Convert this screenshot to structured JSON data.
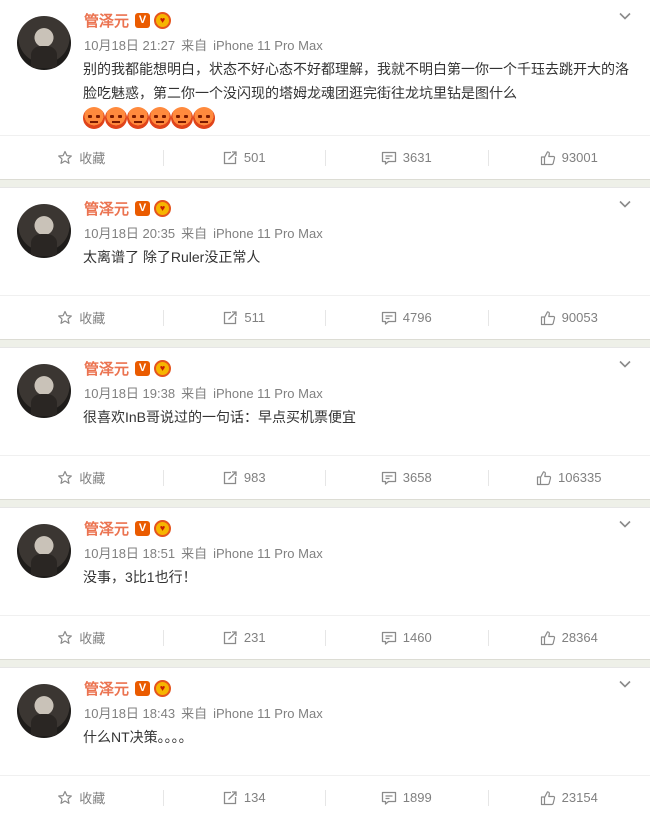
{
  "posts": [
    {
      "author": "管泽元",
      "date": "10月18日 21:27",
      "source_prefix": "来自",
      "device": "iPhone 11 Pro Max",
      "text": "别的我都能想明白，状态不好心态不好都理解，我就不明白第一你一个千珏去跳开大的洛脸吃魅惑，第二你一个没闪现的塔姆龙魂团逛完街往龙坑里钻是图什么",
      "emoji_count": 6,
      "favorite_label": "收藏",
      "reposts": "501",
      "comments": "3631",
      "likes": "93001"
    },
    {
      "author": "管泽元",
      "date": "10月18日 20:35",
      "source_prefix": "来自",
      "device": "iPhone 11 Pro Max",
      "text": "太离谱了 除了Ruler没正常人",
      "emoji_count": 0,
      "favorite_label": "收藏",
      "reposts": "511",
      "comments": "4796",
      "likes": "90053"
    },
    {
      "author": "管泽元",
      "date": "10月18日 19:38",
      "source_prefix": "来自",
      "device": "iPhone 11 Pro Max",
      "text": "很喜欢InB哥说过的一句话：早点买机票便宜",
      "emoji_count": 0,
      "favorite_label": "收藏",
      "reposts": "983",
      "comments": "3658",
      "likes": "106335"
    },
    {
      "author": "管泽元",
      "date": "10月18日 18:51",
      "source_prefix": "来自",
      "device": "iPhone 11 Pro Max",
      "text": "没事，3比1也行！",
      "emoji_count": 0,
      "favorite_label": "收藏",
      "reposts": "231",
      "comments": "1460",
      "likes": "28364"
    },
    {
      "author": "管泽元",
      "date": "10月18日 18:43",
      "source_prefix": "来自",
      "device": "iPhone 11 Pro Max",
      "text": "什么NT决策。。。。",
      "emoji_count": 0,
      "favorite_label": "收藏",
      "reposts": "134",
      "comments": "1899",
      "likes": "23154"
    }
  ],
  "colors": {
    "nickname": "#eb7350",
    "meta": "#808080",
    "text": "#333333",
    "verified_badge": "#ea5b00"
  },
  "icons": {
    "verified": "V",
    "menu": "chevron-down-icon",
    "favorite": "star-icon",
    "repost": "repost-icon",
    "comment": "comment-icon",
    "like": "thumbs-up-icon"
  }
}
